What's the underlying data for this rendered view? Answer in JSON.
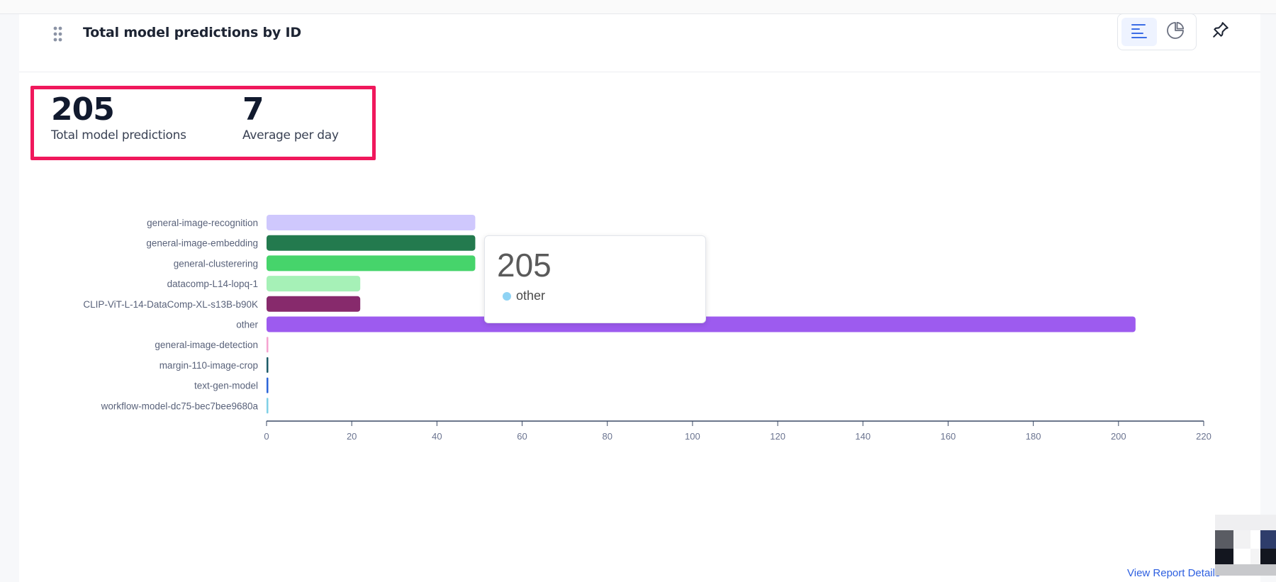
{
  "card": {
    "title": "Total model predictions by ID"
  },
  "stats": [
    {
      "value": "205",
      "label": "Total model predictions"
    },
    {
      "value": "7",
      "label": "Average per day"
    }
  ],
  "tooltip": {
    "value": "205",
    "series": "other",
    "dot_color": "#8fd3f4"
  },
  "footer": {
    "report_link": "View Report Details"
  },
  "icons": {
    "drag": "drag-handle-icon",
    "bar_view": "bar-chart-icon",
    "pie_view": "pie-chart-icon",
    "pin": "pin-icon"
  },
  "colors": {
    "highlight_border": "#f0185c",
    "accent": "#2d5fe0"
  },
  "chart_data": {
    "type": "bar",
    "orientation": "horizontal",
    "categories": [
      "general-image-recognition",
      "general-image-embedding",
      "general-clusterering",
      "datacomp-L14-lopq-1",
      "CLIP-ViT-L-14-DataComp-XL-s13B-b90K",
      "other",
      "general-image-detection",
      "margin-110-image-crop",
      "text-gen-model",
      "workflow-model-dc75-bec7bee9680a"
    ],
    "values": [
      49,
      49,
      49,
      22,
      22,
      204,
      0,
      0,
      0,
      0
    ],
    "colors": [
      "#cfc8fd",
      "#237a4e",
      "#46d46b",
      "#a6f1b7",
      "#872a6c",
      "#9d5bef",
      "#f5a3d0",
      "#1b5a66",
      "#2b64d8",
      "#7fd0e6"
    ],
    "xlim": [
      0,
      220
    ],
    "xticks": [
      0,
      20,
      40,
      60,
      80,
      100,
      120,
      140,
      160,
      180,
      200,
      220
    ],
    "grid": false,
    "legend": "none"
  }
}
